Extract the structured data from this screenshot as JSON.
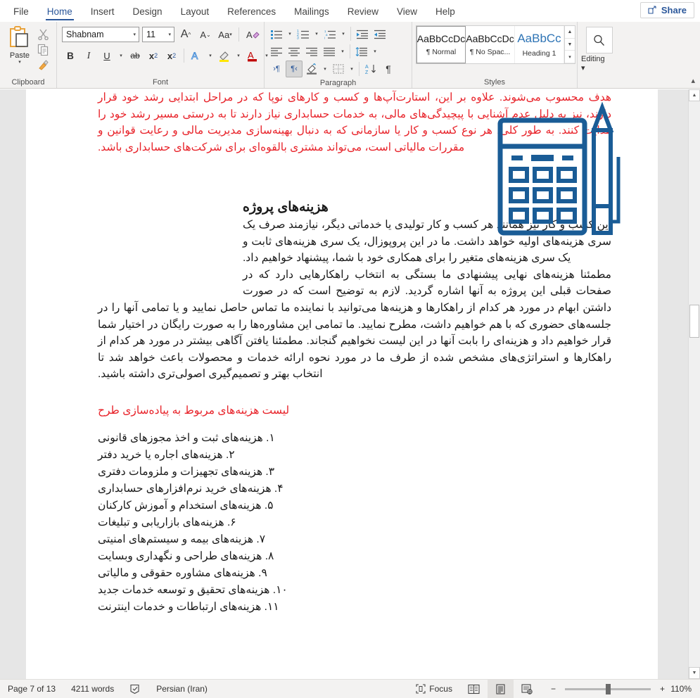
{
  "app": {
    "tabs": [
      {
        "label": "File",
        "active": false
      },
      {
        "label": "Home",
        "active": true
      },
      {
        "label": "Insert",
        "active": false
      },
      {
        "label": "Design",
        "active": false
      },
      {
        "label": "Layout",
        "active": false
      },
      {
        "label": "References",
        "active": false
      },
      {
        "label": "Mailings",
        "active": false
      },
      {
        "label": "Review",
        "active": false
      },
      {
        "label": "View",
        "active": false
      },
      {
        "label": "Help",
        "active": false
      }
    ],
    "share_label": "Share"
  },
  "ribbon": {
    "clipboard": {
      "label": "Clipboard",
      "paste_label": "Paste",
      "icons": [
        "paste-icon",
        "cut-scissors-icon",
        "copy-icon",
        "format-painter-icon"
      ],
      "dialog_launcher": "⌐"
    },
    "font": {
      "label": "Font",
      "font_name": "Shabnam",
      "font_size": "11",
      "grow_font": "A",
      "shrink_font": "A",
      "change_case": "Aa",
      "clear_formatting": "A",
      "bold": "B",
      "italic": "I",
      "underline": "U",
      "strikethrough": "ab",
      "subscript": "x",
      "superscript": "x",
      "text_effects": "A",
      "highlight": "A",
      "font_color": "A"
    },
    "paragraph": {
      "label": "Paragraph",
      "buttons": [
        "bullets-icon",
        "numbering-icon",
        "multilevel-list-icon",
        "decrease-indent-icon",
        "increase-indent-icon",
        "align-left-icon",
        "align-center-icon",
        "align-right-icon",
        "justify-icon",
        "line-spacing-icon",
        "ltr-text-direction-icon",
        "rtl-text-direction-icon",
        "shading-icon",
        "borders-icon",
        "sort-icon",
        "show-marks-icon"
      ]
    },
    "styles": {
      "label": "Styles",
      "items": [
        {
          "preview": "AaBbCcDc",
          "name": "¶ Normal",
          "selected": true
        },
        {
          "preview": "AaBbCcDc",
          "name": "¶ No Spac...",
          "selected": false
        },
        {
          "preview": "AaBbCc",
          "name": "Heading 1",
          "selected": false
        }
      ]
    },
    "editing": {
      "label": "Editing",
      "icon": "search-icon"
    }
  },
  "document": {
    "red_intro": "هدف محسوب می‌شوند. علاوه بر این، استارت‌آپ‌ها و کسب و کارهای نوپا که در مراحل ابتدایی رشد خود قرار دارند، نیز به دلیل عدم آشنایی با پیچیدگی‌های مالی، به خدمات حسابداری نیاز دارند تا به درستی مسیر رشد خود را هدایت کنند. به طور کلی، هر نوع کسب و کار یا سازمانی که به دنبال بهینه‌سازی مدیریت مالی و رعایت قوانین و مقررات مالیاتی است، می‌تواند مشتری بالقوه‌ای برای شرکت‌های حسابداری باشد.",
    "heading": "هزینه‌های پروژه",
    "para1": "این کسب و کار نیز همانند هر کسب و کار تولیدی یا خدماتی دیگر، نیازمند صرف یک سری هزینه‌های اولیه خواهد داشت. ما در این پروپوزال، یک سری هزینه‌های ثابت و یک سری هزینه‌های متغیر را برای همکاری خود با شما، پیشنهاد خواهیم داد.",
    "para2": "مطمئنا هزینه‌های نهایی پیشنهادی ما بستگی به انتخاب راهکارهایی دارد که در صفحات قبلی این پروژه به آنها اشاره گردید. لازم به توضیح است که در صورت داشتن ابهام در مورد هر کدام از راهکارها و هزینه‌ها می‌توانید با نماینده ما تماس حاصل نمایید و یا تمامی آنها را در جلسه‌های حضوری که با هم خواهیم داشت، مطرح نمایید. ما تمامی این مشاوره‌ها را به صورت رایگان در اختیار شما قرار خواهیم داد و هزینه‌ای را بابت آنها در این لیست نخواهیم گنجاند. مطمئنا یافتن آگاهی بیشتر در مورد هر کدام از راهکارها و استراتژی‌های مشخص شده از طرف ما در مورد نحوه ارائه خدمات و محصولات باعث خواهد شد تا انتخاب بهتر و تصمیم‌گیری اصولی‌تری داشته باشید.",
    "sub_red": "لیست هزینه‌های مربوط به پیاده‌سازی طرح",
    "list": [
      "١. هزینه‌های ثبت و اخذ مجوزهای قانونی",
      "٢. هزینه‌های اجاره یا خرید دفتر",
      "٣. هزینه‌های تجهیزات و ملزومات دفتری",
      "۴. هزینه‌های خرید نرم‌افزارهای حسابداری",
      "۵. هزینه‌های استخدام و آموزش کارکنان",
      "۶. هزینه‌های بازاریابی و تبلیغات",
      "٧. هزینه‌های بیمه و سیستم‌های امنیتی",
      "٨. هزینه‌های طراحی و نگهداری وبسایت",
      "٩. هزینه‌های مشاوره حقوقی و مالیاتی",
      "١٠. هزینه‌های تحقیق و توسعه خدمات جدید",
      "١١. هزینه‌های ارتباطات و خدمات اینترنت"
    ],
    "graphic_name": "calculator-and-pencil-illustration",
    "graphic_color": "#1a5c96"
  },
  "status": {
    "page": "Page 7 of 13",
    "words": "4211 words",
    "proofing_icon": "proofing-errors-icon",
    "language": "Persian (Iran)",
    "focus": "Focus",
    "view_read": "read-mode-icon",
    "view_print": "print-layout-icon",
    "view_web": "web-layout-icon",
    "zoom_out": "−",
    "zoom_in": "+",
    "zoom_value": "110%"
  },
  "colors": {
    "accent": "#2b579a",
    "red_text": "#e8232a",
    "graphic_blue": "#1a5c96",
    "ribbon_bg": "#f3f2f1"
  }
}
